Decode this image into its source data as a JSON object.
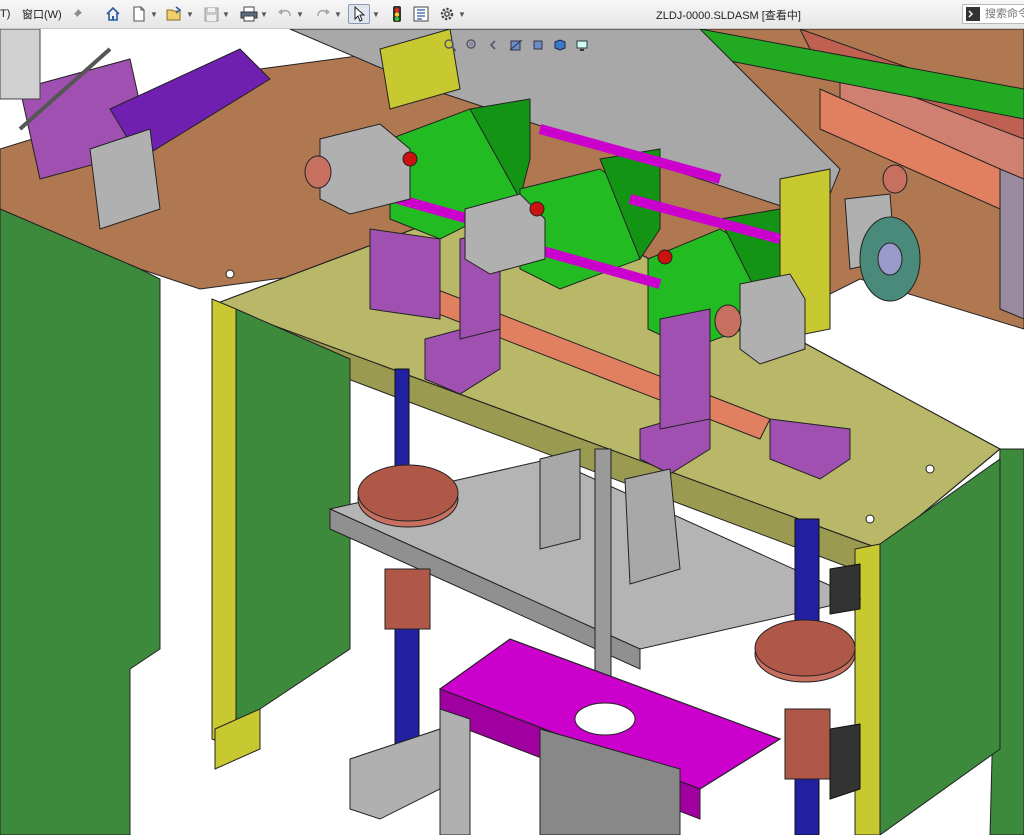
{
  "menu": {
    "partial_left": "T)",
    "window_label": "窗口(W)"
  },
  "toolbar": {
    "icons": [
      "pin-icon",
      "home-icon",
      "new-document-icon",
      "open-folder-icon",
      "save-icon",
      "print-icon",
      "undo-icon",
      "redo-icon",
      "select-pointer-icon",
      "rebuild-icon",
      "file-properties-icon",
      "options-gear-icon"
    ]
  },
  "document": {
    "title": "ZLDJ-0000.SLDASM [查看中]"
  },
  "search": {
    "placeholder": "搜索命令"
  },
  "colors": {
    "green_part": "#22bb22",
    "magenta_part": "#cc00cc",
    "purple_part": "#a050b0",
    "olive_plate": "#b8b868",
    "gray_part": "#b0b0b0",
    "brown_part": "#c87060",
    "copper_part": "#e08060",
    "blue_rod": "#2020a0",
    "dark_green_frame": "#3d8a3d",
    "yellow_frame": "#c8c830",
    "wood_base": "#b07850",
    "red_knob": "#cc1111"
  }
}
